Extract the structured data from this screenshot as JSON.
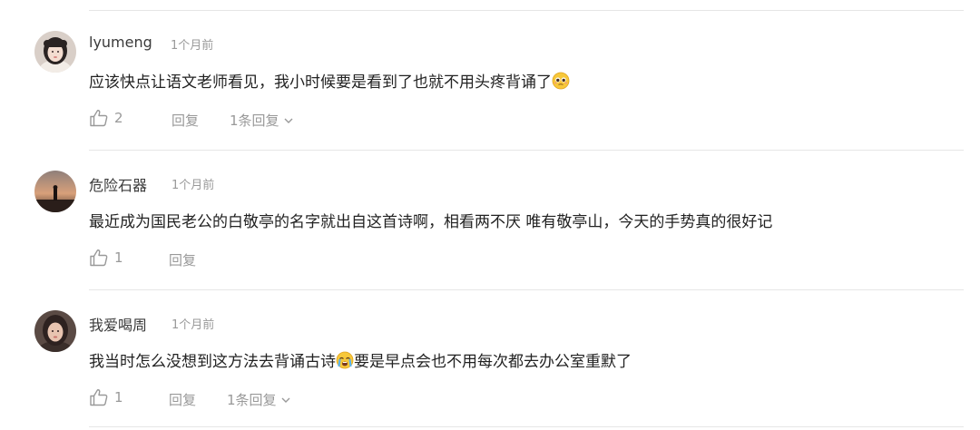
{
  "comments": [
    {
      "username": "lyumeng",
      "time": "1个月前",
      "text": "应该快点让语文老师看见，我小时候要是看到了也就不用头疼背诵了",
      "emoji": "pleading-face-emoji",
      "likes": "2",
      "reply_label": "回复",
      "replies_label": "1条回复"
    },
    {
      "username": "危险石器",
      "time": "1个月前",
      "text": "最近成为国民老公的白敬亭的名字就出自这首诗啊，相看两不厌 唯有敬亭山，今天的手势真的很好记",
      "likes": "1",
      "reply_label": "回复"
    },
    {
      "username": "我爱喝周",
      "time": "1个月前",
      "text_before": "我当时怎么没想到这方法去背诵古诗",
      "emoji": "crying-face-emoji",
      "text_after": "要是早点会也不用每次都去办公室重默了",
      "likes": "1",
      "reply_label": "回复",
      "replies_label": "1条回复"
    }
  ],
  "colors": {
    "text": "#222222",
    "muted": "#999999",
    "username": "#3a3a3a",
    "divider": "#e6e6e6"
  }
}
